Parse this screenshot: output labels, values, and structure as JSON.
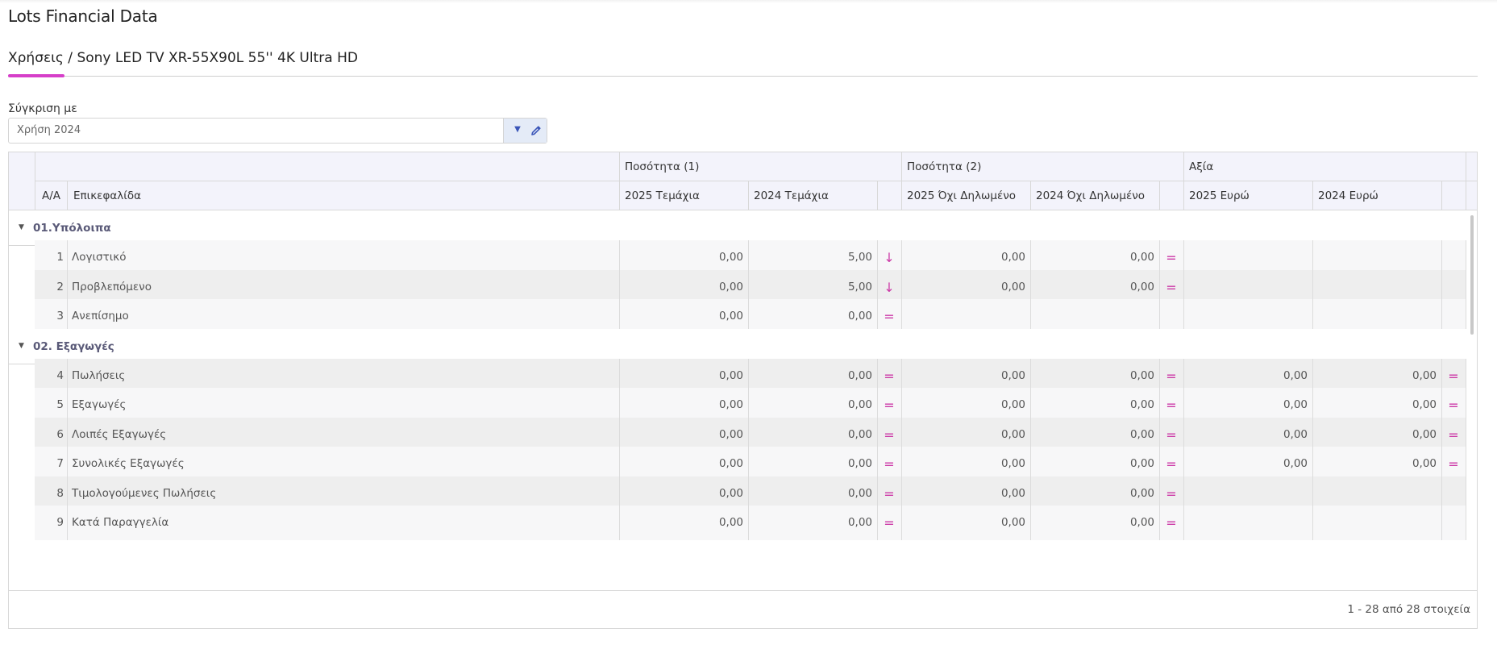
{
  "page": {
    "title": "Lots Financial Data"
  },
  "breadcrumb": {
    "text": "Χρήσεις / Sony LED TV XR-55X90L 55'' 4K Ultra HD"
  },
  "compare": {
    "label": "Σύγκριση με",
    "value": "Χρήση 2024"
  },
  "colors": {
    "accent": "#d63fc9",
    "indicator": "#cc3aa7",
    "header_bg": "#f3f3fb"
  },
  "grid": {
    "group_headers": {
      "qty1": "Ποσότητα (1)",
      "qty2": "Ποσότητα (2)",
      "value": "Αξία"
    },
    "columns": {
      "aa": "Α/Α",
      "title": "Επικεφαλίδα",
      "q1_2025": "2025 Τεμάχια",
      "q1_2024": "2024 Τεμάχια",
      "q2_2025": "2025 Όχι Δηλωμένο",
      "q2_2024": "2024 Όχι Δηλωμένο",
      "v_2025": "2025 Ευρώ",
      "v_2024": "2024 Ευρώ"
    },
    "groups": [
      {
        "title": "01.Υπόλοιπα",
        "rows": [
          {
            "n": "1",
            "label": "Λογιστικό",
            "q1a": "0,00",
            "q1b": "5,00",
            "q1i": "↓",
            "q2a": "0,00",
            "q2b": "0,00",
            "q2i": "=",
            "va": "",
            "vb": "",
            "vi": ""
          },
          {
            "n": "2",
            "label": "Προβλεπόμενο",
            "q1a": "0,00",
            "q1b": "5,00",
            "q1i": "↓",
            "q2a": "0,00",
            "q2b": "0,00",
            "q2i": "=",
            "va": "",
            "vb": "",
            "vi": ""
          },
          {
            "n": "3",
            "label": "Ανεπίσημο",
            "q1a": "0,00",
            "q1b": "0,00",
            "q1i": "=",
            "q2a": "",
            "q2b": "",
            "q2i": "",
            "va": "",
            "vb": "",
            "vi": ""
          }
        ]
      },
      {
        "title": "02. Εξαγωγές",
        "rows": [
          {
            "n": "4",
            "label": "Πωλήσεις",
            "q1a": "0,00",
            "q1b": "0,00",
            "q1i": "=",
            "q2a": "0,00",
            "q2b": "0,00",
            "q2i": "=",
            "va": "0,00",
            "vb": "0,00",
            "vi": "="
          },
          {
            "n": "5",
            "label": "Εξαγωγές",
            "q1a": "0,00",
            "q1b": "0,00",
            "q1i": "=",
            "q2a": "0,00",
            "q2b": "0,00",
            "q2i": "=",
            "va": "0,00",
            "vb": "0,00",
            "vi": "="
          },
          {
            "n": "6",
            "label": "Λοιπές Εξαγωγές",
            "q1a": "0,00",
            "q1b": "0,00",
            "q1i": "=",
            "q2a": "0,00",
            "q2b": "0,00",
            "q2i": "=",
            "va": "0,00",
            "vb": "0,00",
            "vi": "="
          },
          {
            "n": "7",
            "label": "Συνολικές Εξαγωγές",
            "q1a": "0,00",
            "q1b": "0,00",
            "q1i": "=",
            "q2a": "0,00",
            "q2b": "0,00",
            "q2i": "=",
            "va": "0,00",
            "vb": "0,00",
            "vi": "="
          },
          {
            "n": "8",
            "label": "Τιμολογούμενες Πωλήσεις",
            "q1a": "0,00",
            "q1b": "0,00",
            "q1i": "=",
            "q2a": "0,00",
            "q2b": "0,00",
            "q2i": "=",
            "va": "",
            "vb": "",
            "vi": ""
          },
          {
            "n": "9",
            "label": "Κατά Παραγγελία",
            "q1a": "0,00",
            "q1b": "0,00",
            "q1i": "=",
            "q2a": "0,00",
            "q2b": "0,00",
            "q2i": "=",
            "va": "",
            "vb": "",
            "vi": ""
          }
        ]
      }
    ],
    "pager": "1 - 28 από 28 στοιχεία"
  }
}
